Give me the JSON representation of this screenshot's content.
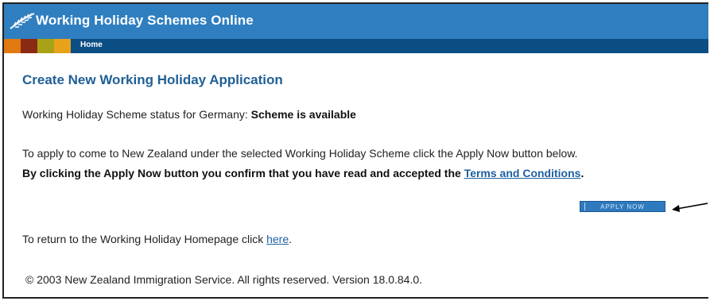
{
  "header": {
    "title": "Working Holiday Schemes Online",
    "logo_icon": "fern-icon",
    "background": "#2f7fc0"
  },
  "nav": {
    "home_label": "Home",
    "swatch_colors": [
      "#e07a10",
      "#8a2a12",
      "#a8a217",
      "#e8a21a"
    ]
  },
  "page": {
    "title": "Create New Working Holiday Application",
    "status_label": "Working Holiday Scheme status for Germany:",
    "status_value": "Scheme is available",
    "instructions": "To apply to come to New Zealand under the selected Working Holiday Scheme click the Apply Now button below.",
    "confirm_text": "By clicking the Apply Now button you confirm that you have read and accepted the",
    "terms_link": "Terms and Conditions",
    "confirm_end": ".",
    "apply_button": "APPLY NOW",
    "return_text": "To return to the Working Holiday Homepage click",
    "return_link": "here",
    "return_end": ".",
    "copyright": "© 2003 New Zealand Immigration Service. All rights reserved. Version 18.0.84.0."
  }
}
